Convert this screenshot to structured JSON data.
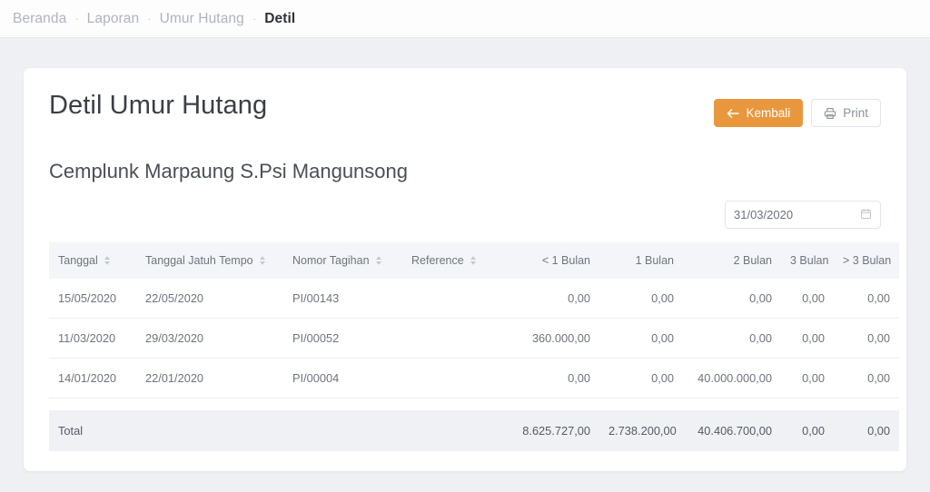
{
  "breadcrumb": {
    "separator": "·",
    "items": [
      {
        "label": "Beranda",
        "active": false
      },
      {
        "label": "Laporan",
        "active": false
      },
      {
        "label": "Umur Hutang",
        "active": false
      },
      {
        "label": "Detil",
        "active": true
      }
    ]
  },
  "page": {
    "title": "Detil Umur Hutang",
    "subtitle": "Cemplunk Marpaung S.Psi Mangunsong"
  },
  "actions": {
    "back_label": "Kembali",
    "back_icon": "arrow-left-icon",
    "back_color": "#e9973d",
    "print_label": "Print",
    "print_icon": "printer-icon"
  },
  "filter": {
    "date_value": "31/03/2020",
    "date_placeholder": "dd/mm/yyyy",
    "calendar_icon": "calendar-icon"
  },
  "table": {
    "columns": [
      {
        "label": "Tanggal",
        "align": "left",
        "sortable": true
      },
      {
        "label": "Tanggal Jatuh Tempo",
        "align": "left",
        "sortable": true
      },
      {
        "label": "Nomor Tagihan",
        "align": "left",
        "sortable": true
      },
      {
        "label": "Reference",
        "align": "left",
        "sortable": true
      },
      {
        "label": "< 1 Bulan",
        "align": "right",
        "sortable": false
      },
      {
        "label": "1 Bulan",
        "align": "right",
        "sortable": false
      },
      {
        "label": "2 Bulan",
        "align": "right",
        "sortable": false
      },
      {
        "label": "3 Bulan",
        "align": "right",
        "sortable": false
      },
      {
        "label": "> 3 Bulan",
        "align": "right",
        "sortable": false
      }
    ],
    "rows": [
      {
        "tanggal": "15/05/2020",
        "jatuh_tempo": "22/05/2020",
        "nomor_tagihan": "PI/00143",
        "reference": "",
        "lt1": "0,00",
        "m1": "0,00",
        "m2": "0,00",
        "m3": "0,00",
        "gt3": "0,00"
      },
      {
        "tanggal": "11/03/2020",
        "jatuh_tempo": "29/03/2020",
        "nomor_tagihan": "PI/00052",
        "reference": "",
        "lt1": "360.000,00",
        "m1": "0,00",
        "m2": "0,00",
        "m3": "0,00",
        "gt3": "0,00"
      },
      {
        "tanggal": "14/01/2020",
        "jatuh_tempo": "22/01/2020",
        "nomor_tagihan": "PI/00004",
        "reference": "",
        "lt1": "0,00",
        "m1": "0,00",
        "m2": "40.000.000,00",
        "m3": "0,00",
        "gt3": "0,00"
      }
    ],
    "total": {
      "label": "Total",
      "lt1": "8.625.727,00",
      "m1": "2.738.200,00",
      "m2": "40.406.700,00",
      "m3": "0,00",
      "gt3": "0,00"
    }
  }
}
